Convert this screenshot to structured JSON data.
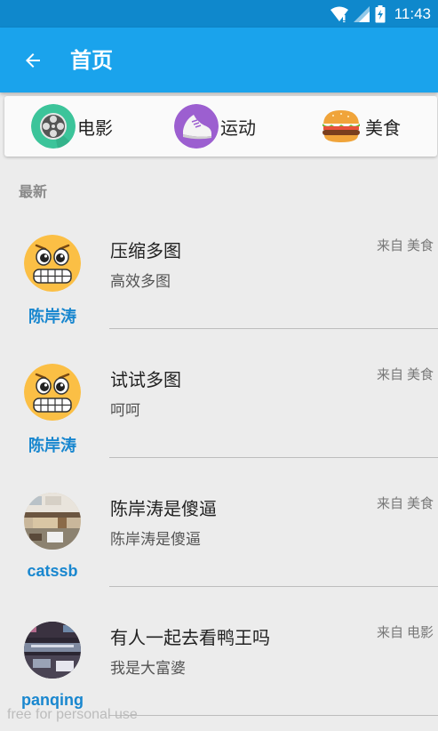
{
  "status_bar": {
    "time": "11:43",
    "icons": [
      "wifi-icon",
      "signal-icon",
      "battery-icon"
    ]
  },
  "app_bar": {
    "title": "首页",
    "back_icon": "arrow-left-icon"
  },
  "categories": [
    {
      "label": "电影",
      "icon": "film-reel-icon"
    },
    {
      "label": "运动",
      "icon": "sneaker-icon"
    },
    {
      "label": "美食",
      "icon": "burger-icon"
    }
  ],
  "section_title": "最新",
  "from_label": "来自",
  "posts": [
    {
      "user": "陈岸涛",
      "title": "压缩多图",
      "body": "高效多图",
      "category": "美食",
      "avatar": "grimace-emoji-icon"
    },
    {
      "user": "陈岸涛",
      "title": "试试多图",
      "body": "呵呵",
      "category": "美食",
      "avatar": "grimace-emoji-icon"
    },
    {
      "user": "catssb",
      "title": "陈岸涛是傻逼",
      "body": "陈岸涛是傻逼",
      "category": "美食",
      "avatar": "room-photo-avatar"
    },
    {
      "user": "panqing",
      "title": "有人一起去看鸭王吗",
      "body": "我是大富婆",
      "category": "电影",
      "avatar": "dark-photo-avatar"
    }
  ],
  "watermark": "free for personal use",
  "colors": {
    "status_bar": "#0f88cc",
    "app_bar": "#1aa3ec",
    "username": "#1987cf",
    "background": "#ececec"
  }
}
